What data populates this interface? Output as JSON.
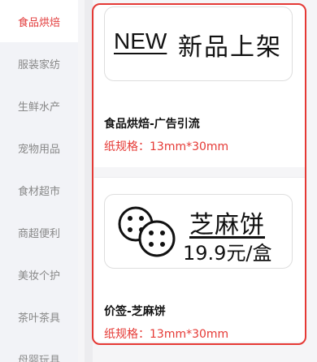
{
  "sidebar": {
    "items": [
      {
        "label": "食品烘焙"
      },
      {
        "label": "服装家纺"
      },
      {
        "label": "生鲜水产"
      },
      {
        "label": "宠物用品"
      },
      {
        "label": "食材超市"
      },
      {
        "label": "商超便利"
      },
      {
        "label": "美妆个护"
      },
      {
        "label": "茶叶茶具"
      },
      {
        "label": "母婴玩具"
      }
    ],
    "active_index": 0
  },
  "products": [
    {
      "banner": {
        "new_text": "NEW",
        "title": "新品上架"
      },
      "title": "食品烘焙-广告引流",
      "spec": "纸规格：13mm*30mm"
    },
    {
      "banner": {
        "title": "芝麻饼",
        "price": "19.9元/盒"
      },
      "icon": "cookie-icon",
      "title": "价签-芝麻饼",
      "spec": "纸规格：13mm*30mm"
    }
  ],
  "colors": {
    "accent": "#e53935",
    "sidebar_bg": "#f2f3f7",
    "active_text": "#e23b3b"
  }
}
